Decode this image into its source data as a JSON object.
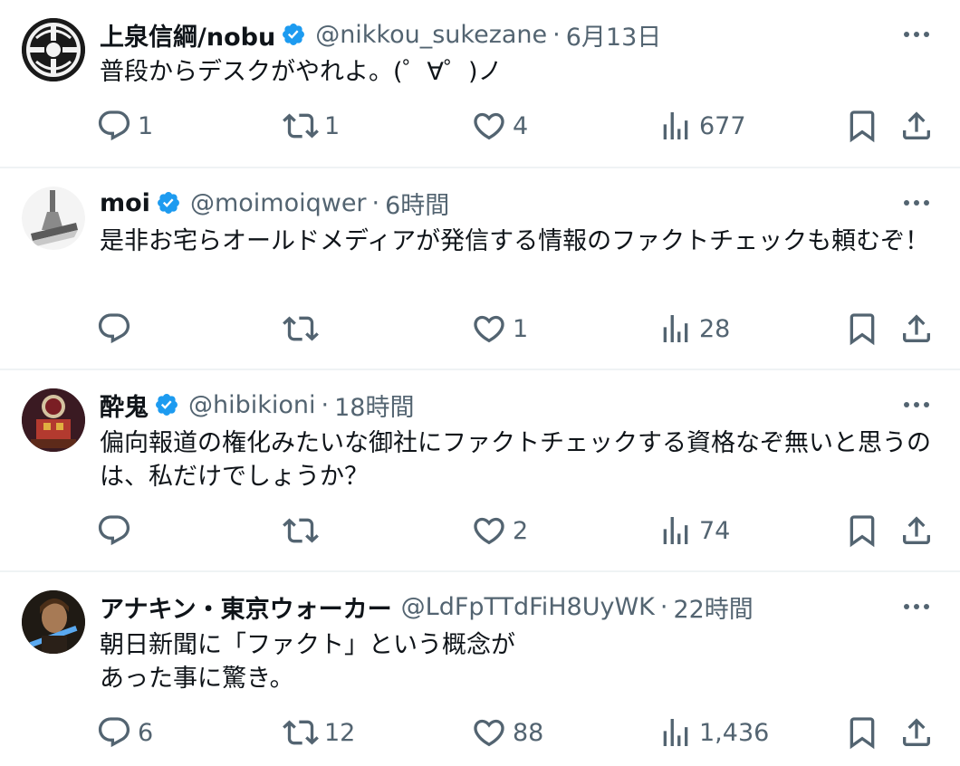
{
  "colors": {
    "text_primary": "#0f1419",
    "text_secondary": "#536471",
    "verified_blue": "#1d9bf0",
    "divider": "#eff3f4"
  },
  "posts": [
    {
      "name": "上泉信綱/nobu",
      "handle": "@nikkou_sukezane",
      "separator": "·",
      "time": "6月13日",
      "verified": true,
      "avatar_icon": "crest-avatar",
      "text": "普段からデスクがやれよ。(゜∀゜)ノ",
      "replies": "1",
      "reposts": "1",
      "likes": "4",
      "views": "677"
    },
    {
      "name": "moi",
      "handle": "@moimoiqwer",
      "separator": "·",
      "time": "6時間",
      "verified": true,
      "avatar_icon": "monument-avatar",
      "text": "是非お宅らオールドメディアが発信する情報のファクトチェックも頼むぞ！",
      "replies": "",
      "reposts": "",
      "likes": "1",
      "views": "28"
    },
    {
      "name": "酔鬼",
      "handle": "@hibikioni",
      "separator": "·",
      "time": "18時間",
      "verified": true,
      "avatar_icon": "artwork-avatar",
      "text": "偏向報道の権化みたいな御社にファクトチェックする資格なぞ無いと思うのは、私だけでしょうか？",
      "replies": "",
      "reposts": "",
      "likes": "2",
      "views": "74"
    },
    {
      "name": "アナキン・東京ウォーカー",
      "handle": "@LdFpTTdFiH8UyWK",
      "separator": "·",
      "time": "22時間",
      "verified": false,
      "avatar_icon": "portrait-avatar",
      "text": "朝日新聞に「ファクト」という概念が\nあった事に驚き。",
      "replies": "6",
      "reposts": "12",
      "likes": "88",
      "views": "1,436"
    }
  ]
}
